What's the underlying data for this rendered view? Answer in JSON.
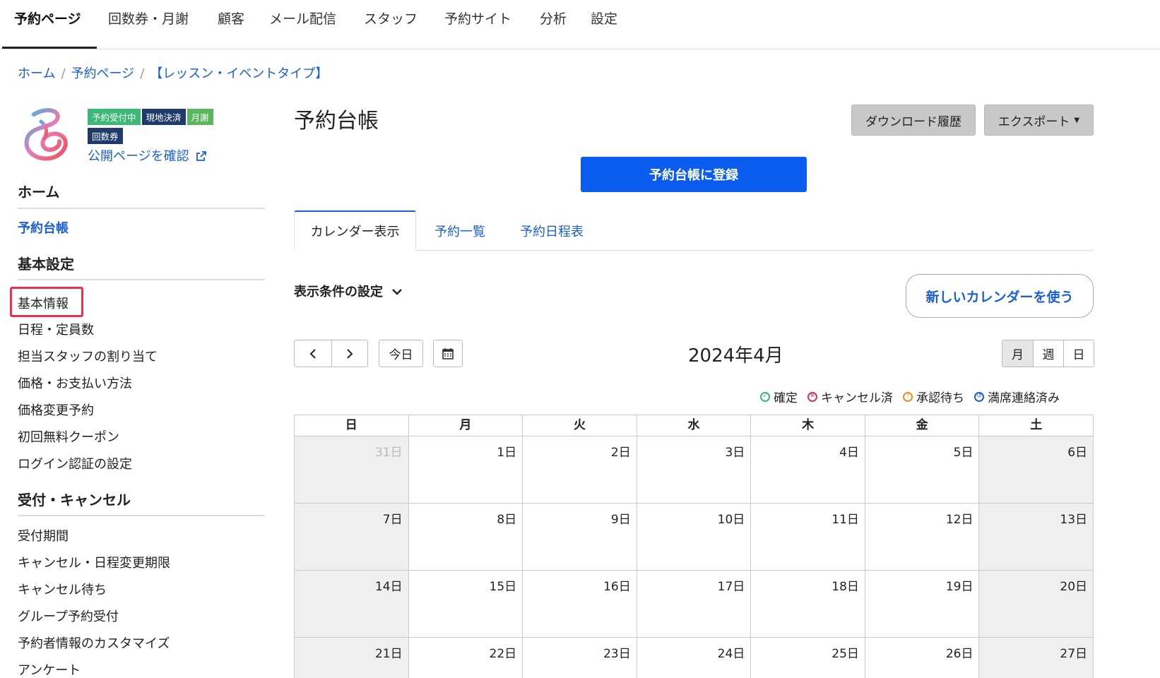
{
  "topnav": {
    "items": [
      "予約ページ",
      "回数券・月謝",
      "顧客",
      "メール配信",
      "スタッフ",
      "予約サイト",
      "分析",
      "設定"
    ]
  },
  "breadcrumb": {
    "home": "ホーム",
    "reservation_page": "予約ページ",
    "current": "【レッスン・イベントタイプ】"
  },
  "badges": [
    "予約受付中",
    "現地決済",
    "月謝",
    "回数券"
  ],
  "public_link": "公開ページを確認",
  "sidebar": {
    "home_heading": "ホーム",
    "ledger_link": "予約台帳",
    "basic_heading": "基本設定",
    "basic_items": [
      "基本情報",
      "日程・定員数",
      "担当スタッフの割り当て",
      "価格・お支払い方法",
      "価格変更予約",
      "初回無料クーポン",
      "ログイン認証の設定"
    ],
    "reception_heading": "受付・キャンセル",
    "reception_items": [
      "受付期間",
      "キャンセル・日程変更期限",
      "キャンセル待ち",
      "グループ予約受付",
      "予約者情報のカスタマイズ",
      "アンケート"
    ]
  },
  "main": {
    "title": "予約台帳",
    "download_history": "ダウンロード履歴",
    "export": "エクスポート",
    "register_button": "予約台帳に登録",
    "tabs": [
      "カレンダー表示",
      "予約一覧",
      "予約日程表"
    ],
    "filter_label": "表示条件の設定",
    "new_calendar_button": "新しいカレンダーを使う",
    "today_button": "今日",
    "month_title": "2024年4月",
    "views": [
      "月",
      "週",
      "日"
    ],
    "legend": [
      {
        "label": "確定",
        "color": "#3cb878"
      },
      {
        "label": "キャンセル済",
        "color": "#d9304f"
      },
      {
        "label": "承認待ち",
        "color": "#f08a24"
      },
      {
        "label": "満席連絡済み",
        "color": "#1a5fd8"
      }
    ]
  },
  "calendar": {
    "weekdays": [
      "日",
      "月",
      "火",
      "水",
      "木",
      "金",
      "土"
    ],
    "weeks": [
      [
        "31日",
        "1日",
        "2日",
        "3日",
        "4日",
        "5日",
        "6日"
      ],
      [
        "7日",
        "8日",
        "9日",
        "10日",
        "11日",
        "12日",
        "13日"
      ],
      [
        "14日",
        "15日",
        "16日",
        "17日",
        "18日",
        "19日",
        "20日"
      ],
      [
        "21日",
        "22日",
        "23日",
        "24日",
        "25日",
        "26日",
        "27日"
      ]
    ]
  }
}
